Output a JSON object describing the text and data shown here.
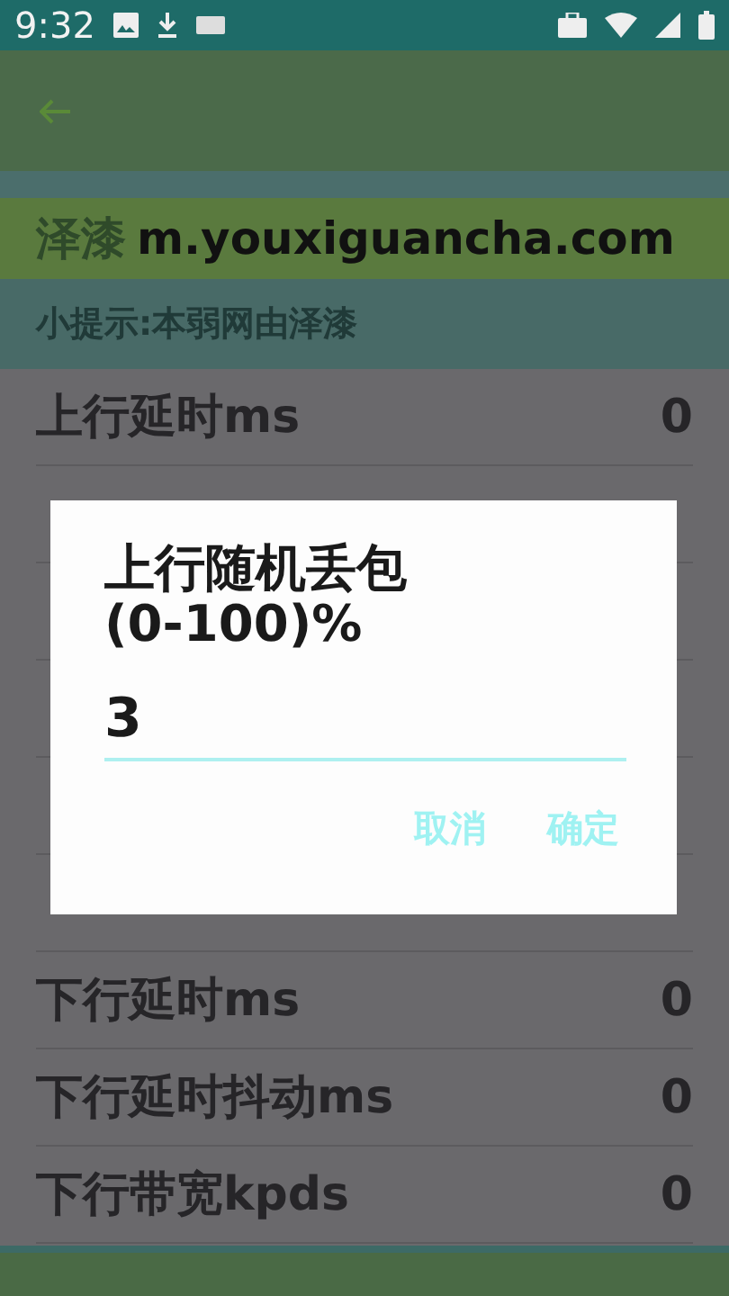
{
  "banner": {
    "author": "泽漆",
    "url": "m.youxiguancha.com"
  },
  "tip": "小提示:本弱网由泽漆",
  "settings": [
    {
      "label": "上行延时ms",
      "value": "0"
    },
    {
      "label": "下行延时ms",
      "value": "0"
    },
    {
      "label": "下行延时抖动ms",
      "value": "0"
    },
    {
      "label": "下行带宽kpds",
      "value": "0"
    }
  ],
  "dialog": {
    "title": "上行随机丢包\n(0-100)%",
    "value": "3",
    "buttons": [
      "取消",
      "确定"
    ]
  },
  "status_bar": {
    "time": "9:32"
  }
}
